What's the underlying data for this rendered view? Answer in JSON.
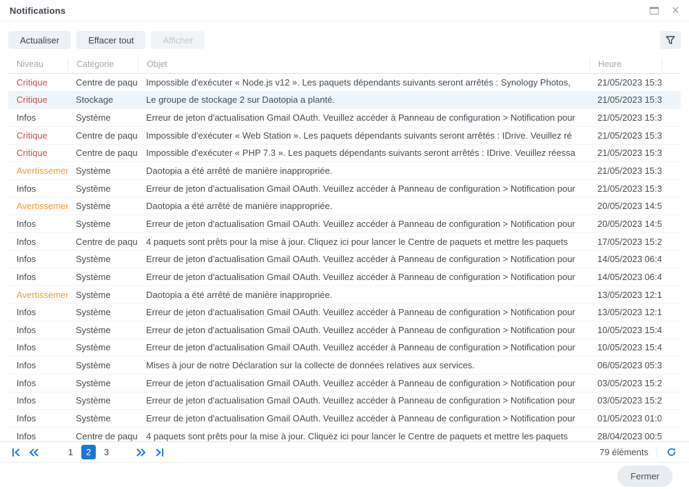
{
  "window": {
    "title": "Notifications"
  },
  "toolbar": {
    "refresh_label": "Actualiser",
    "clear_all_label": "Effacer tout",
    "show_label": "Afficher"
  },
  "table": {
    "columns": {
      "level": "Niveau",
      "category": "Catégorie",
      "subject": "Objet",
      "time": "Heure"
    },
    "rows": [
      {
        "level": "Critique",
        "type": "critical",
        "category": "Centre de paquets",
        "subject": "Impossible d'exécuter « Node.js v12 ». Les paquets dépendants suivants seront arrêtés : Synology Photos,",
        "time": "21/05/2023 15:3",
        "selected": false
      },
      {
        "level": "Critique",
        "type": "critical",
        "category": "Stockage",
        "subject": "Le groupe de stockage 2 sur Daotopia a planté.",
        "time": "21/05/2023 15:3",
        "selected": true
      },
      {
        "level": "Infos",
        "type": "info",
        "category": "Système",
        "subject": "Erreur de jeton d'actualisation Gmail OAuth. Veuillez accéder à Panneau de configuration > Notification pour",
        "time": "21/05/2023 15:3",
        "selected": false
      },
      {
        "level": "Critique",
        "type": "critical",
        "category": "Centre de paquets",
        "subject": "Impossible d'exécuter « Web Station ». Les paquets dépendants suivants seront arrêtés : IDrive. Veuillez ré",
        "time": "21/05/2023 15:3",
        "selected": false
      },
      {
        "level": "Critique",
        "type": "critical",
        "category": "Centre de paquets",
        "subject": "Impossible d'exécuter « PHP 7.3 ». Les paquets dépendants suivants seront arrêtés : IDrive. Veuillez réessa",
        "time": "21/05/2023 15:3",
        "selected": false
      },
      {
        "level": "Avertissement",
        "type": "warning",
        "category": "Système",
        "subject": "Daotopia a été arrêté de manière inappropriée.",
        "time": "21/05/2023 15:3",
        "selected": false
      },
      {
        "level": "Infos",
        "type": "info",
        "category": "Système",
        "subject": "Erreur de jeton d'actualisation Gmail OAuth. Veuillez accéder à Panneau de configuration > Notification pour",
        "time": "21/05/2023 15:3",
        "selected": false
      },
      {
        "level": "Avertissement",
        "type": "warning",
        "category": "Système",
        "subject": "Daotopia a été arrêté de manière inappropriée.",
        "time": "20/05/2023 14:5",
        "selected": false
      },
      {
        "level": "Infos",
        "type": "info",
        "category": "Système",
        "subject": "Erreur de jeton d'actualisation Gmail OAuth. Veuillez accéder à Panneau de configuration > Notification pour",
        "time": "20/05/2023 14:5",
        "selected": false
      },
      {
        "level": "Infos",
        "type": "info",
        "category": "Centre de paquets",
        "subject": "4 paquets sont prêts pour la mise à jour. Cliquez ici pour lancer le Centre de paquets et mettre les paquets",
        "time": "17/05/2023 15:2",
        "selected": false
      },
      {
        "level": "Infos",
        "type": "info",
        "category": "Système",
        "subject": "Erreur de jeton d'actualisation Gmail OAuth. Veuillez accéder à Panneau de configuration > Notification pour",
        "time": "14/05/2023 06:4",
        "selected": false
      },
      {
        "level": "Infos",
        "type": "info",
        "category": "Système",
        "subject": "Erreur de jeton d'actualisation Gmail OAuth. Veuillez accéder à Panneau de configuration > Notification pour",
        "time": "14/05/2023 06:4",
        "selected": false
      },
      {
        "level": "Avertissement",
        "type": "warning",
        "category": "Système",
        "subject": "Daotopia a été arrêté de manière inappropriée.",
        "time": "13/05/2023 12:1",
        "selected": false
      },
      {
        "level": "Infos",
        "type": "info",
        "category": "Système",
        "subject": "Erreur de jeton d'actualisation Gmail OAuth. Veuillez accéder à Panneau de configuration > Notification pour",
        "time": "13/05/2023 12:1",
        "selected": false
      },
      {
        "level": "Infos",
        "type": "info",
        "category": "Système",
        "subject": "Erreur de jeton d'actualisation Gmail OAuth. Veuillez accéder à Panneau de configuration > Notification pour",
        "time": "10/05/2023 15:4",
        "selected": false
      },
      {
        "level": "Infos",
        "type": "info",
        "category": "Système",
        "subject": "Erreur de jeton d'actualisation Gmail OAuth. Veuillez accéder à Panneau de configuration > Notification pour",
        "time": "10/05/2023 15:4",
        "selected": false
      },
      {
        "level": "Infos",
        "type": "info",
        "category": "Système",
        "subject": "Mises à jour de notre Déclaration sur la collecte de données relatives aux services.",
        "time": "06/05/2023 05:3",
        "selected": false
      },
      {
        "level": "Infos",
        "type": "info",
        "category": "Système",
        "subject": "Erreur de jeton d'actualisation Gmail OAuth. Veuillez accéder à Panneau de configuration > Notification pour",
        "time": "03/05/2023 15:2",
        "selected": false
      },
      {
        "level": "Infos",
        "type": "info",
        "category": "Système",
        "subject": "Erreur de jeton d'actualisation Gmail OAuth. Veuillez accéder à Panneau de configuration > Notification pour",
        "time": "03/05/2023 15:2",
        "selected": false
      },
      {
        "level": "Infos",
        "type": "info",
        "category": "Système",
        "subject": "Erreur de jeton d'actualisation Gmail OAuth. Veuillez accéder à Panneau de configuration > Notification pour",
        "time": "01/05/2023 01:0",
        "selected": false
      },
      {
        "level": "Infos",
        "type": "info",
        "category": "Centre de paquets",
        "subject": "4 paquets sont prêts pour la mise à jour. Cliquez ici pour lancer le Centre de paquets et mettre les paquets",
        "time": "28/04/2023 00:5",
        "selected": false
      }
    ]
  },
  "pagination": {
    "pages": [
      "1",
      "2",
      "3"
    ],
    "current_page": "2",
    "items_count": "79 éléments"
  },
  "footer": {
    "close_label": "Fermer"
  },
  "icons": {
    "titlebar": [
      "maximize-icon",
      "close-icon"
    ],
    "toolbar": [
      "filter-funnel-icon"
    ],
    "pagination": [
      "first-page-icon",
      "previous-page-icon",
      "next-page-icon",
      "last-page-icon",
      "refresh-icon"
    ]
  },
  "colors": {
    "critical_text": "#c4534c",
    "warning_text": "#eb9c3e",
    "info_text": "#464c52",
    "accent_blue": "#1878d4",
    "selected_row_bg": "#eef6fc"
  }
}
